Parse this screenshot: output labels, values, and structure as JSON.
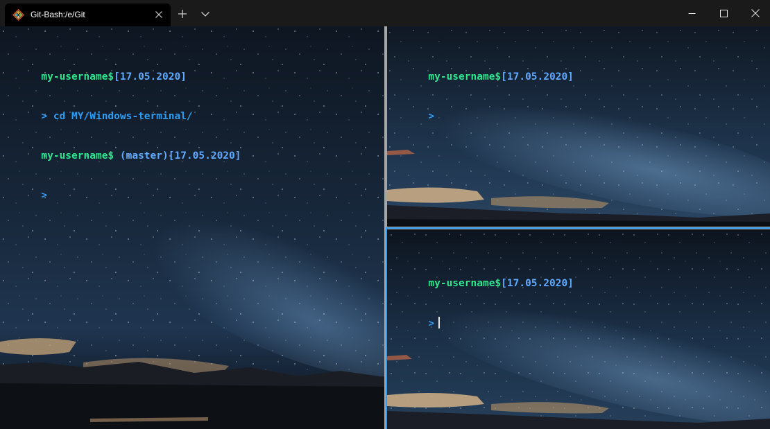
{
  "window": {
    "tab_title": "Git-Bash:/e/Git",
    "tab_icon": "git-bash-icon",
    "colors": {
      "titlebar": "#1a1a1a",
      "tab_active": "#000000",
      "focus_border": "#2f9cf2",
      "user_text": "#2ee68c",
      "date_text": "#61a9ff",
      "prompt_text": "#2f9cf2"
    }
  },
  "panes": {
    "left": {
      "lines": [
        {
          "user": "my-username$",
          "branch": "",
          "date": "[17.05.2020]"
        },
        {
          "prompt": "> ",
          "command": "cd MY/Windows-terminal/"
        },
        {
          "user": "my-username$",
          "branch": " (master)",
          "date": "[17.05.2020]"
        },
        {
          "prompt": ">",
          "command": ""
        }
      ]
    },
    "top_right": {
      "lines": [
        {
          "user": "my-username$",
          "date": "[17.05.2020]"
        },
        {
          "prompt": ">"
        }
      ]
    },
    "bottom_right": {
      "lines": [
        {
          "user": "my-username$",
          "date": "[17.05.2020]"
        },
        {
          "prompt": ">"
        }
      ]
    }
  }
}
